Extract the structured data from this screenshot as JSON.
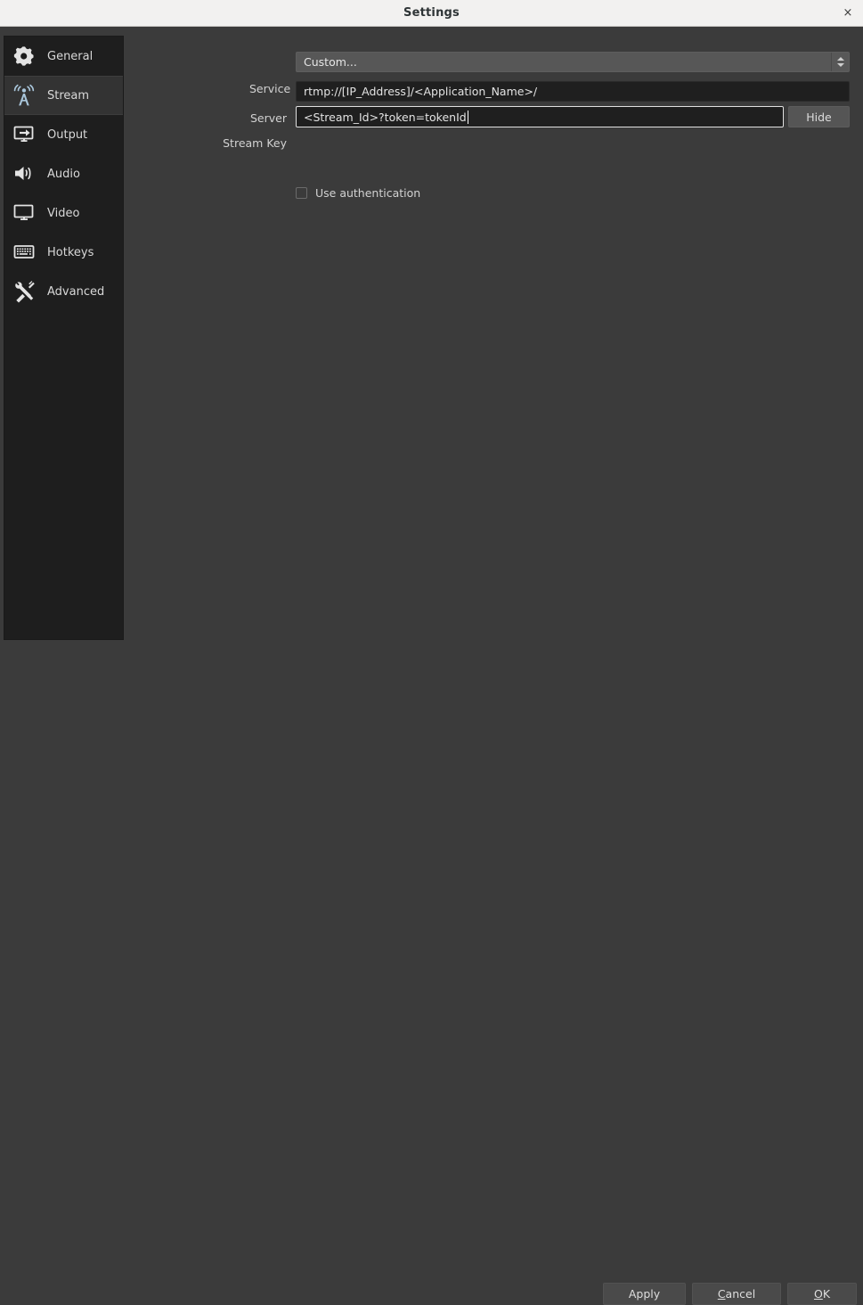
{
  "window": {
    "title": "Settings",
    "close_label": "×"
  },
  "sidebar": {
    "items": [
      {
        "label": "General",
        "icon": "gear-icon",
        "selected": false
      },
      {
        "label": "Stream",
        "icon": "broadcast-icon",
        "selected": true
      },
      {
        "label": "Output",
        "icon": "output-icon",
        "selected": false
      },
      {
        "label": "Audio",
        "icon": "speaker-icon",
        "selected": false
      },
      {
        "label": "Video",
        "icon": "monitor-icon",
        "selected": false
      },
      {
        "label": "Hotkeys",
        "icon": "keyboard-icon",
        "selected": false
      },
      {
        "label": "Advanced",
        "icon": "tools-icon",
        "selected": false
      }
    ]
  },
  "stream_settings": {
    "service": {
      "label": "Service",
      "value": "Custom...",
      "options": [
        "Custom..."
      ]
    },
    "server": {
      "label": "Server",
      "value": "rtmp://[IP_Address]/<Application_Name>/",
      "placeholder": ""
    },
    "stream_key": {
      "label": "Stream Key",
      "value": "<Stream_Id>?token=tokenId",
      "placeholder": "",
      "hide_button_label": "Hide",
      "focused": true
    },
    "use_authentication": {
      "label": "Use authentication",
      "checked": false
    }
  },
  "footer": {
    "apply_label": "Apply",
    "cancel_label": "Cancel",
    "cancel_mnemonic": "C",
    "ok_label": "OK",
    "ok_mnemonic": "O"
  },
  "colors": {
    "titlebar_bg": "#f2f1f0",
    "sidebar_bg": "#1e1e1e",
    "content_bg": "#3b3b3b",
    "selected_item_bg": "#333333",
    "input_bg": "#1f1f1f",
    "combo_bg": "#575757",
    "button_bg": "#4a4a4a",
    "accent_icon": "#a9c6db"
  }
}
